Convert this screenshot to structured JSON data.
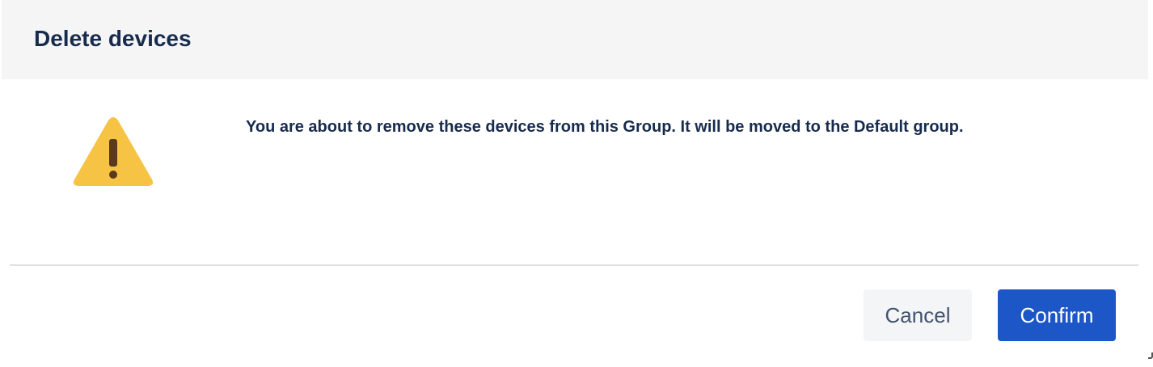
{
  "dialog": {
    "title": "Delete devices",
    "message": "You are about to remove these devices from this Group. It will be moved to the Default group.",
    "icon": "warning-icon",
    "buttons": {
      "cancel_label": "Cancel",
      "confirm_label": "Confirm"
    }
  },
  "colors": {
    "header_background": "#f5f5f5",
    "title_text": "#172b4d",
    "warning_icon_fill": "#f6c344",
    "warning_icon_mark": "#5a3a1a",
    "cancel_background": "#f4f5f7",
    "cancel_text": "#42526e",
    "confirm_background": "#1c56c7",
    "confirm_text": "#ffffff"
  }
}
